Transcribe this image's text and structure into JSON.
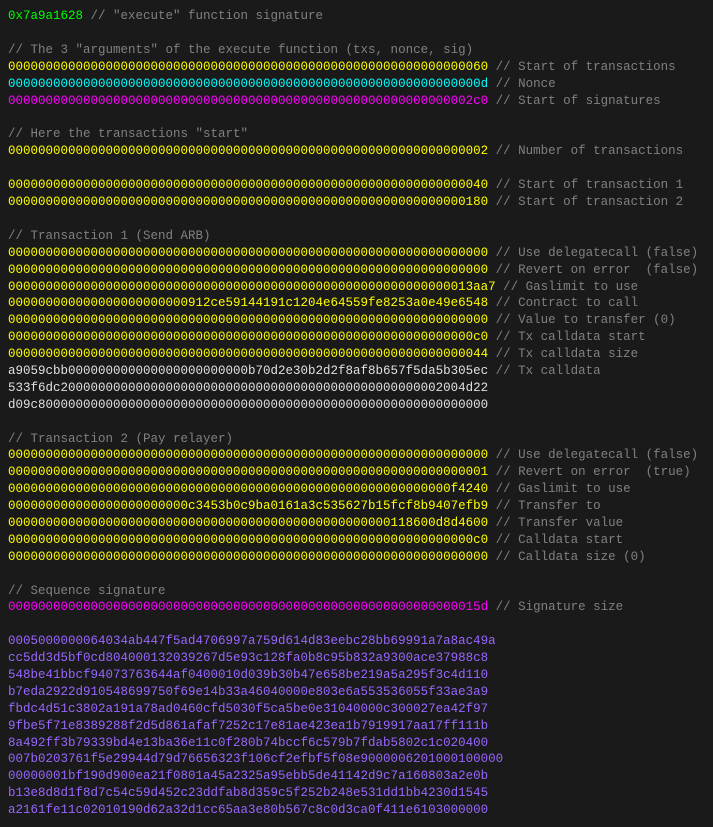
{
  "sig_selector": "0x7a9a1628",
  "sig_comment": " // \"execute\" function signature",
  "args_header": "// The 3 \"arguments\" of the execute function (txs, nonce, sig)",
  "args": [
    {
      "hex": "0000000000000000000000000000000000000000000000000000000000000060",
      "c": "yellow",
      "comment": " // Start of transactions"
    },
    {
      "hex": "000000000000000000000000000000000000000000000000000000000000000d",
      "c": "cyan",
      "comment": " // Nonce"
    },
    {
      "hex": "00000000000000000000000000000000000000000000000000000000000002c0",
      "c": "magenta",
      "comment": " // Start of signatures"
    }
  ],
  "txstart_header": "// Here the transactions \"start\"",
  "numtx": {
    "hex": "0000000000000000000000000000000000000000000000000000000000000002",
    "comment": " // Number of transactions"
  },
  "offsets": [
    {
      "hex": "0000000000000000000000000000000000000000000000000000000000000040",
      "comment": " // Start of transaction 1"
    },
    {
      "hex": "0000000000000000000000000000000000000000000000000000000000000180",
      "comment": " // Start of transaction 2"
    }
  ],
  "tx1_header": "// Transaction 1 (Send ARB)",
  "tx1": [
    {
      "hex": "0000000000000000000000000000000000000000000000000000000000000000",
      "comment": " // Use delegatecall (false)"
    },
    {
      "hex": "0000000000000000000000000000000000000000000000000000000000000000",
      "comment": " // Revert on error  (false)"
    },
    {
      "hex": "00000000000000000000000000000000000000000000000000000000000013aa7",
      "comment": " // Gaslimit to use"
    },
    {
      "hex": "000000000000000000000000912ce59144191c1204e64559fe8253a0e49e6548",
      "comment": " // Contract to call"
    },
    {
      "hex": "0000000000000000000000000000000000000000000000000000000000000000",
      "comment": " // Value to transfer (0)"
    },
    {
      "hex": "00000000000000000000000000000000000000000000000000000000000000c0",
      "comment": " // Tx calldata start"
    },
    {
      "hex": "0000000000000000000000000000000000000000000000000000000000000044",
      "comment": " // Tx calldata size"
    }
  ],
  "tx1_calldata_first": "a9059cbb000000000000000000000000b70d2e30b2d2f8af8b657f5da5b305ec",
  "tx1_calldata_first_comment": " // Tx calldata",
  "tx1_calldata_rest": [
    "533f6dc200000000000000000000000000000000000000000000000002004d22",
    "d09c800000000000000000000000000000000000000000000000000000000000"
  ],
  "tx2_header": "// Transaction 2 (Pay relayer)",
  "tx2": [
    {
      "hex": "0000000000000000000000000000000000000000000000000000000000000000",
      "comment": " // Use delegatecall (false)"
    },
    {
      "hex": "0000000000000000000000000000000000000000000000000000000000000001",
      "comment": " // Revert on error  (true)"
    },
    {
      "hex": "00000000000000000000000000000000000000000000000000000000000f4240",
      "comment": " // Gaslimit to use"
    },
    {
      "hex": "000000000000000000000000c3453b0c9ba0161a3c535627b15fcf8b9407efb9",
      "comment": " // Transfer to"
    },
    {
      "hex": "000000000000000000000000000000000000000000000000000118600d8d4600",
      "comment": " // Transfer value"
    },
    {
      "hex": "00000000000000000000000000000000000000000000000000000000000000c0",
      "comment": " // Calldata start"
    },
    {
      "hex": "0000000000000000000000000000000000000000000000000000000000000000",
      "comment": " // Calldata size (0)"
    }
  ],
  "seq_header": "// Sequence signature",
  "sigsize": {
    "hex": "000000000000000000000000000000000000000000000000000000000000015d",
    "comment": " // Signature size"
  },
  "sigdata": [
    "0005000000064034ab447f5ad4706997a759d614d83eebc28bb69991a7a8ac49a",
    "cc5dd3d5bf0cd804000132039267d5e93c128fa0b8c95b832a9300ace37988c8",
    "548be41bbcf94073763644af0400010d039b30b47e658be219a5a295f3c4d110",
    "b7eda2922d910548699750f69e14b33a46040000e803e6a553536055f33ae3a9",
    "fbdc4d51c3802a191a78ad0460cfd5030f5ca5be0e31040000c300027ea42f97",
    "9fbe5f71e8389288f2d5d861afaf7252c17e81ae423ea1b7919917aa17ff111b",
    "8a492ff3b79339bd4e13ba36e11c0f280b74bccf6c579b7fdab5802c1c020400",
    "007b0203761f5e29944d79d76656323f106cf2efbf5f08e9000006201000100000",
    "00000001bf190d900ea21f0801a45a2325a95ebb5de41142d9c7a160803a2e0b",
    "b13e8d8d1f8d7c54c59d452c23ddfab8d359c5f252b248e531dd1bb4230d1545",
    "a2161fe11c02010190d62a32d1cc65aa3e80b567c8c0d3ca0f411e6103000000"
  ]
}
